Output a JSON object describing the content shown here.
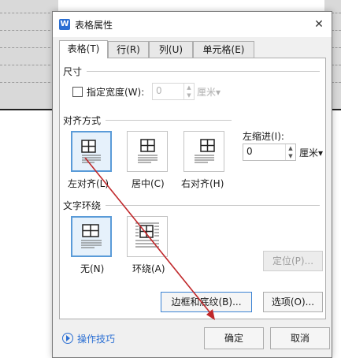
{
  "window": {
    "title": "表格属性",
    "app_icon_letter": "W",
    "close_glyph": "✕"
  },
  "tabs": [
    {
      "label": "表格(T)",
      "active": true
    },
    {
      "label": "行(R)",
      "active": false
    },
    {
      "label": "列(U)",
      "active": false
    },
    {
      "label": "单元格(E)",
      "active": false
    }
  ],
  "size": {
    "section_label": "尺寸",
    "width_checkbox_label": "指定宽度(W):",
    "width_value": "0",
    "width_unit": "厘米▾"
  },
  "alignment": {
    "section_label": "对齐方式",
    "options": [
      {
        "label": "左对齐(L)",
        "selected": true
      },
      {
        "label": "居中(C)",
        "selected": false
      },
      {
        "label": "右对齐(H)",
        "selected": false
      }
    ],
    "indent_label": "左缩进(I):",
    "indent_value": "0",
    "indent_unit": "厘米▾"
  },
  "wrapping": {
    "section_label": "文字环绕",
    "options": [
      {
        "label": "无(N)",
        "selected": true
      },
      {
        "label": "环绕(A)",
        "selected": false
      }
    ],
    "position_button": "定位(P)..."
  },
  "buttons": {
    "borders_shading": "边框和底纹(B)...",
    "options": "选项(O)...",
    "ok": "确定",
    "cancel": "取消"
  },
  "help_link": "操作技巧",
  "colors": {
    "accent": "#2b6fd3",
    "selected_border": "#5a9bd8",
    "arrow": "#c0282b"
  }
}
